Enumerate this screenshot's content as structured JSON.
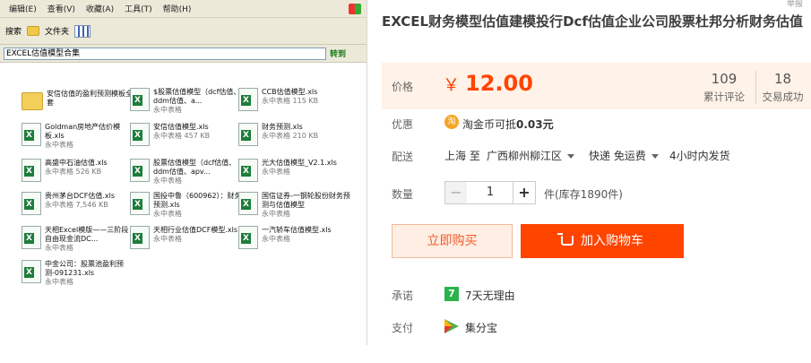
{
  "explorer": {
    "menu": [
      "编辑(E)",
      "查看(V)",
      "收藏(A)",
      "工具(T)",
      "帮助(H)"
    ],
    "toolbar": {
      "search_label": "搜索",
      "folders_label": "文件夹"
    },
    "address": "EXCEL估值模型合集",
    "go_label": "转到",
    "files": [
      {
        "name": "安信估值的盈利预测模板全套",
        "sub": "",
        "icon": "folder-icon"
      },
      {
        "name": "$股票估值模型（dcf估值、ddm估值、a...",
        "sub": "永中表格",
        "icon": "excel-icon"
      },
      {
        "name": "CCB估值模型.xls",
        "sub": "永中表格 115 KB",
        "icon": "excel-icon"
      },
      {
        "name": "Goldman房地产估价模板.xls",
        "sub": "永中表格",
        "icon": "excel-icon"
      },
      {
        "name": "安信估值模型.xls",
        "sub": "永中表格 457 KB",
        "icon": "excel-icon"
      },
      {
        "name": "财务预测.xls",
        "sub": "永中表格 210 KB",
        "icon": "excel-icon"
      },
      {
        "name": "高盛中石油估值.xls",
        "sub": "永中表格 526 KB",
        "icon": "excel-icon"
      },
      {
        "name": "股票估值模型（dcf估值、ddm估值、apv...",
        "sub": "永中表格",
        "icon": "excel-icon"
      },
      {
        "name": "光大估值模型_V2.1.xls",
        "sub": "永中表格",
        "icon": "excel-icon"
      },
      {
        "name": "贵州茅台DCF估值.xls",
        "sub": "永中表格 7,546 KB",
        "icon": "excel-icon"
      },
      {
        "name": "国投中鲁（600962）：财务预测.xls",
        "sub": "永中表格",
        "icon": "excel-icon"
      },
      {
        "name": "国信证券-一钢轮股份财务预测与估值模型",
        "sub": "永中表格",
        "icon": "excel-icon"
      },
      {
        "name": "天相Excel模版——三阶段自由现金流DC...",
        "sub": "永中表格",
        "icon": "excel-icon"
      },
      {
        "name": "天相行业估值DCF模型.xls",
        "sub": "永中表格",
        "icon": "excel-icon"
      },
      {
        "name": "一汽轿车估值模型.xls",
        "sub": "永中表格",
        "icon": "excel-icon"
      },
      {
        "name": "中金公司：股票池盈利预测-091231.xls",
        "sub": "永中表格",
        "icon": "excel-icon"
      }
    ]
  },
  "corner_text": "举报",
  "product": {
    "title": "EXCEL财务模型估值建模投行Dcf估值企业公司股票杜邦分析财务估值",
    "price_label": "价格",
    "currency": "￥",
    "price": "12.00",
    "reviews_count": "109",
    "reviews_label": "累计评论",
    "sales_count": "18",
    "sales_label": "交易成功",
    "promo_label": "优惠",
    "promo_icon": "淘",
    "promo_text": "淘金币可抵",
    "promo_amount": "0.03元",
    "delivery_label": "配送",
    "ship_from": "上海 至",
    "ship_to": "广西柳州柳江区",
    "shipping": "快递 免运费",
    "ship_time": "4小时内发货",
    "quantity_label": "数量",
    "quantity": "1",
    "stock": "件(库存1890件)",
    "buy_now": "立即购买",
    "add_cart": "加入购物车",
    "promise_label": "承诺",
    "promise_icon": "7",
    "promise_text": "7天无理由",
    "payment_label": "支付",
    "payment_text": "集分宝"
  }
}
